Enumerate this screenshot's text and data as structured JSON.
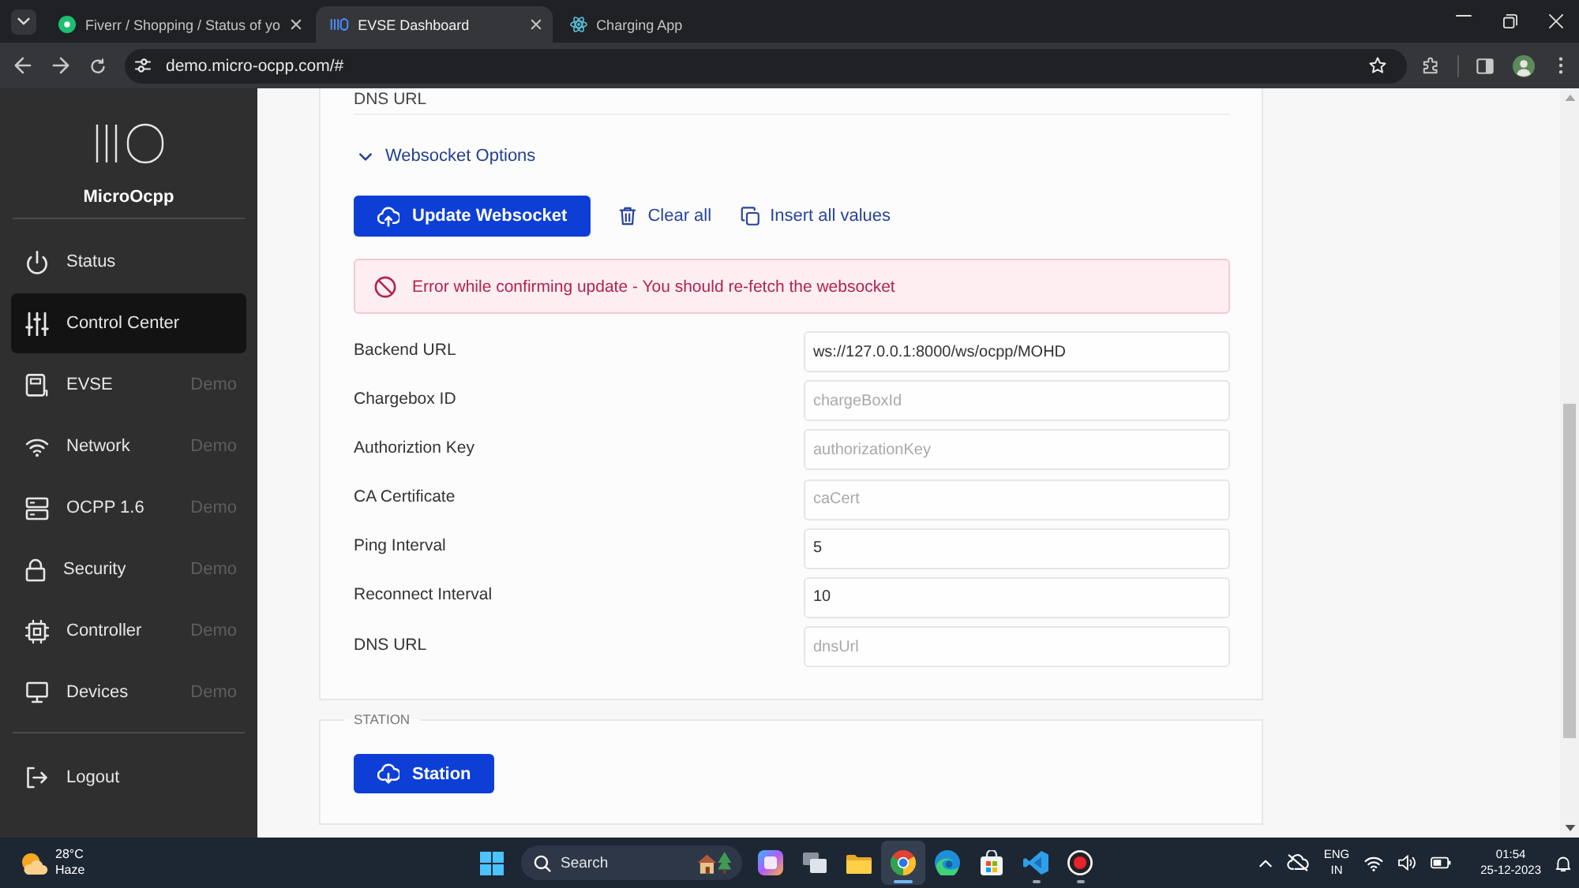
{
  "browser": {
    "tabs": [
      {
        "title": "Fiverr / Shopping / Status of yo",
        "selected": false,
        "closable": true
      },
      {
        "title": "EVSE Dashboard",
        "selected": true,
        "closable": true
      },
      {
        "title": "Charging App",
        "selected": false,
        "closable": false
      }
    ],
    "url": "demo.micro-ocpp.com/#"
  },
  "sidebar": {
    "brand": "MicroOcpp",
    "items": [
      {
        "label": "Status",
        "selected": false
      },
      {
        "label": "Control Center",
        "selected": true
      },
      {
        "label": "EVSE",
        "badge": "Demo",
        "selected": false
      },
      {
        "label": "Network",
        "badge": "Demo",
        "selected": false
      },
      {
        "label": "OCPP 1.6",
        "badge": "Demo",
        "selected": false
      },
      {
        "label": "Security",
        "badge": "Demo",
        "selected": false
      },
      {
        "label": "Controller",
        "badge": "Demo",
        "selected": false
      },
      {
        "label": "Devices",
        "badge": "Demo",
        "selected": false
      }
    ],
    "logout": {
      "label": "Logout"
    }
  },
  "websocket_card": {
    "previous_row_label": "DNS URL",
    "section": {
      "title": "Websocket Options",
      "expanded": true
    },
    "actions": [
      {
        "kind": "primary",
        "label": "Update Websocket"
      },
      {
        "kind": "clear",
        "label": "Clear all"
      },
      {
        "kind": "insert",
        "label": "Insert all values"
      }
    ],
    "alert": {
      "kind": "error",
      "message": "Error while confirming update - You should re-fetch the websocket"
    },
    "fields": [
      {
        "label": "Backend URL",
        "value": "ws://127.0.0.1:8000/ws/ocpp/MOHD"
      },
      {
        "label": "Chargebox ID",
        "placeholder": "chargeBoxId"
      },
      {
        "label": "Authoriztion Key",
        "placeholder": "authorizationKey"
      },
      {
        "label": "CA Certificate",
        "placeholder": "caCert"
      },
      {
        "label": "Ping Interval",
        "value": "5"
      },
      {
        "label": "Reconnect Interval",
        "value": "10"
      },
      {
        "label": "DNS URL",
        "placeholder": "dnsUrl"
      }
    ]
  },
  "station_card": {
    "legend": "STATION",
    "button": {
      "label": "Station"
    }
  },
  "taskbar": {
    "weather": {
      "temperature": "28°C",
      "condition": "Haze"
    },
    "search": {
      "placeholder": "Search"
    },
    "apps": [
      {
        "selected": false,
        "running": false
      },
      {
        "selected": false,
        "running": false
      },
      {
        "selected": false,
        "running": false
      },
      {
        "selected": true,
        "running": true
      },
      {
        "selected": false,
        "running": false
      },
      {
        "selected": false,
        "running": false
      },
      {
        "selected": false,
        "running": true
      },
      {
        "selected": false,
        "running": true
      }
    ],
    "language": {
      "code": "ENG",
      "region": "IN"
    },
    "time": "01:54",
    "date": "25-12-2023"
  }
}
